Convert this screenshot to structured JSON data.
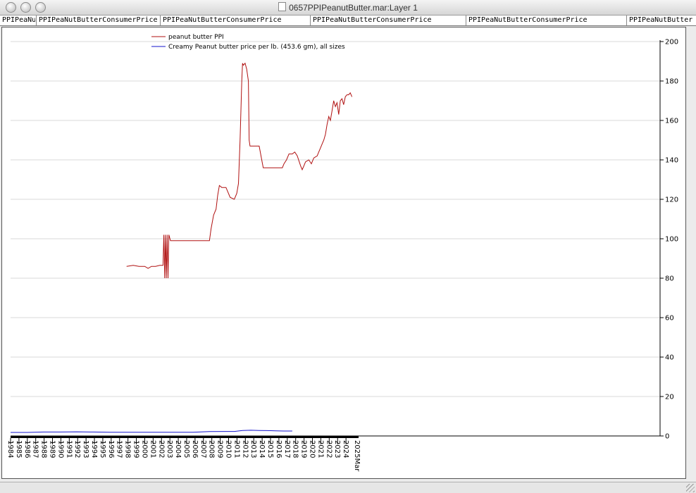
{
  "window": {
    "title": "0657PPIPeanutButter.mar:Layer 1"
  },
  "tabs": [
    "PPIPeaNu",
    "PPIPeaNutButterConsumerPrice",
    "PPIPeaNutButterConsumerPrice",
    "PPIPeaNutButterConsumerPrice",
    "PPIPeaNutButterConsumerPrice",
    "PPIPeaNutButter"
  ],
  "colors": {
    "ppi": "#b01010",
    "price": "#1515cc",
    "grid": "#d8d8d8"
  },
  "chart_data": {
    "type": "line",
    "ylim": [
      0,
      200
    ],
    "yticks": [
      0,
      20,
      40,
      60,
      80,
      100,
      120,
      140,
      160,
      180,
      200
    ],
    "xlim": [
      1984,
      2026
    ],
    "xticks": [
      "1984",
      "1985",
      "1986",
      "1987",
      "1988",
      "1989",
      "1990",
      "1991",
      "1992",
      "1993",
      "1994",
      "1995",
      "1996",
      "1997",
      "1998",
      "1999",
      "2000",
      "2001",
      "2002",
      "2003",
      "2004",
      "2005",
      "2006",
      "2007",
      "2008",
      "2009",
      "2010",
      "2011",
      "2012",
      "2013",
      "2014",
      "2015",
      "2016",
      "2017",
      "2018",
      "2019",
      "2020",
      "2021",
      "2022",
      "2023",
      "2024"
    ],
    "xtick_end": "2025Mar",
    "grid": true,
    "legend_position": "top-left",
    "series": [
      {
        "name": "peanut butter PPI",
        "x": [
          1998.0,
          1998.8,
          1999.5,
          2000.2,
          2000.6,
          2001.0,
          2001.5,
          2002.0,
          2002.4,
          2002.5,
          2002.6,
          2002.7,
          2002.8,
          2002.9,
          2003.0,
          2003.1,
          2003.3,
          2005.0,
          2007.0,
          2008.0,
          2008.2,
          2008.5,
          2008.8,
          2009.0,
          2009.2,
          2009.5,
          2010.0,
          2010.5,
          2011.0,
          2011.3,
          2011.5,
          2011.7,
          2011.9,
          2012.0,
          2012.1,
          2012.3,
          2012.5,
          2012.7,
          2012.8,
          2012.9,
          2013.0,
          2013.5,
          2014.0,
          2014.4,
          2014.5,
          2015.0,
          2016.0,
          2016.8,
          2017.0,
          2017.3,
          2017.6,
          2018.0,
          2018.3,
          2018.6,
          2019.0,
          2019.2,
          2019.4,
          2019.6,
          2020.0,
          2020.3,
          2020.6,
          2021.0,
          2021.2,
          2021.4,
          2021.6,
          2021.8,
          2022.0,
          2022.2,
          2022.4,
          2022.6,
          2022.8,
          2023.0,
          2023.2,
          2023.4,
          2023.6,
          2023.8,
          2024.0,
          2024.2,
          2024.4,
          2024.6,
          2024.8,
          2025.0,
          2025.2
        ],
        "values": [
          86,
          86.5,
          86,
          86,
          85,
          86,
          86,
          86.5,
          86.5,
          102,
          80,
          102,
          80,
          102,
          80,
          102,
          99,
          99,
          99,
          99,
          105,
          112,
          115,
          122,
          127,
          126,
          126,
          121,
          120,
          123,
          128,
          150,
          180,
          189,
          188,
          189,
          186,
          180,
          150,
          147,
          147,
          147,
          147,
          138,
          136,
          136,
          136,
          136,
          138,
          140,
          143,
          143,
          144,
          142,
          137,
          135,
          137,
          139,
          140,
          138,
          141,
          142,
          144,
          146,
          148,
          150,
          153,
          158,
          162,
          160,
          165,
          170,
          167,
          169,
          163,
          170,
          171,
          168,
          172,
          173,
          173,
          174,
          172
        ]
      },
      {
        "name": "Creamy Peanut butter price per lb. (453.6 gm), all sizes",
        "x": [
          1984.0,
          1986.0,
          1988.0,
          1990.0,
          1992.0,
          1994.0,
          1996.0,
          1998.0,
          2000.0,
          2002.0,
          2004.0,
          2006.0,
          2008.0,
          2010.0,
          2011.0,
          2012.0,
          2013.0,
          2014.0,
          2015.0,
          2016.0,
          2017.0,
          2018.0
        ],
        "values": [
          1.8,
          1.8,
          2.0,
          2.0,
          2.1,
          2.0,
          1.9,
          1.9,
          1.9,
          1.9,
          1.9,
          1.9,
          2.2,
          2.3,
          2.3,
          2.8,
          2.9,
          2.8,
          2.7,
          2.6,
          2.5,
          2.5
        ]
      }
    ]
  }
}
